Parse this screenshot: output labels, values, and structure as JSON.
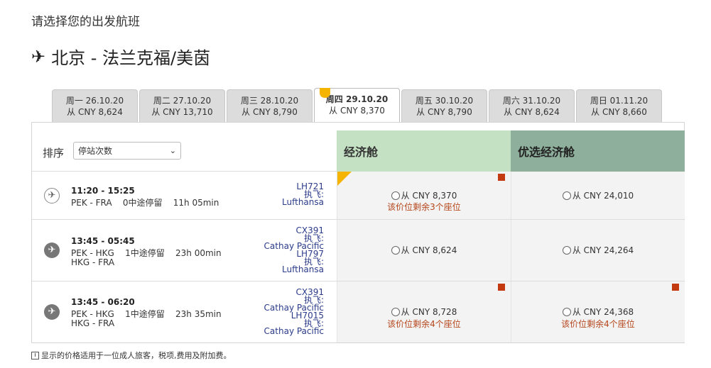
{
  "header": {
    "subtitle": "请选择您的出发航班",
    "route_icon": "airplane-icon",
    "route": "北京 - 法兰克福/美茵"
  },
  "date_tabs": [
    {
      "day": "周一 26.10.20",
      "price": "从 CNY 8,624"
    },
    {
      "day": "周二 27.10.20",
      "price": "从 CNY 13,710"
    },
    {
      "day": "周三 28.10.20",
      "price": "从 CNY 8,790"
    },
    {
      "day": "周四 29.10.20",
      "price": "从 CNY 8,370",
      "active": true
    },
    {
      "day": "周五 30.10.20",
      "price": "从 CNY 8,790"
    },
    {
      "day": "周六 31.10.20",
      "price": "从 CNY 8,624"
    },
    {
      "day": "周日 01.11.20",
      "price": "从 CNY 8,660"
    }
  ],
  "sort": {
    "label": "排序",
    "selected": "停站次数"
  },
  "cabins": {
    "economy": "经济舱",
    "premium_economy": "优选经济舱"
  },
  "flights": [
    {
      "airline_icon": "lufthansa-crane-icon",
      "times": "11:20 - 15:25",
      "leg1_route": "PEK - FRA",
      "leg1_stops": "0中途停留",
      "leg1_duration": "11h 05min",
      "segments": [
        {
          "flight": "LH721",
          "operated": "执飞:",
          "carrier": "Lufthansa"
        }
      ],
      "economy": {
        "price": "从 CNY 8,370",
        "seats": "该价位剩余3个座位"
      },
      "premium": {
        "price": "从 CNY 24,010"
      }
    },
    {
      "airline_icon": "cathay-plane-icon",
      "times": "13:45 - 05:45",
      "leg1_route": "PEK - HKG",
      "leg1_stops": "1中途停留",
      "leg1_duration": "23h 00min",
      "leg2_route": "HKG - FRA",
      "segments": [
        {
          "flight": "CX391",
          "operated": "执飞:",
          "carrier": "Cathay Pacific"
        },
        {
          "flight": "LH797",
          "operated": "执飞:",
          "carrier": "Lufthansa"
        }
      ],
      "economy": {
        "price": "从 CNY 8,624"
      },
      "premium": {
        "price": "从 CNY 24,264"
      }
    },
    {
      "airline_icon": "cathay-plane-icon",
      "times": "13:45 - 06:20",
      "leg1_route": "PEK - HKG",
      "leg1_stops": "1中途停留",
      "leg1_duration": "23h 35min",
      "leg2_route": "HKG - FRA",
      "segments": [
        {
          "flight": "CX391",
          "operated": "执飞:",
          "carrier": "Cathay Pacific"
        },
        {
          "flight": "LH7015",
          "operated": "执飞:",
          "carrier": "Cathay Pacific"
        }
      ],
      "economy": {
        "price": "从 CNY 8,728",
        "seats": "该价位剩余4个座位"
      },
      "premium": {
        "price": "从 CNY 24,368",
        "seats": "该价位剩余4个座位"
      }
    }
  ],
  "footnote": {
    "icon": "info-icon",
    "text": "显示的价格适用于一位成人旅客，税项,费用及附加费。"
  }
}
